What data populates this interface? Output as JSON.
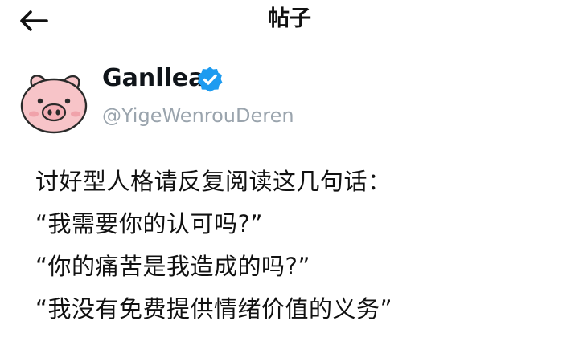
{
  "header": {
    "back_icon": "arrow-left-icon",
    "title": "帖子"
  },
  "author": {
    "avatar_icon": "pig-avatar-icon",
    "name": "Ganllea",
    "verified_icon": "verified-badge-icon",
    "verified_color": "#1d9bf0",
    "handle": "@YigeWenrouDeren"
  },
  "post": {
    "lines": [
      "讨好型人格请反复阅读这几句话：",
      "“我需要你的认可吗?”",
      "“你的痛苦是我造成的吗?”",
      "“我没有免费提供情绪价值的义务”"
    ]
  }
}
